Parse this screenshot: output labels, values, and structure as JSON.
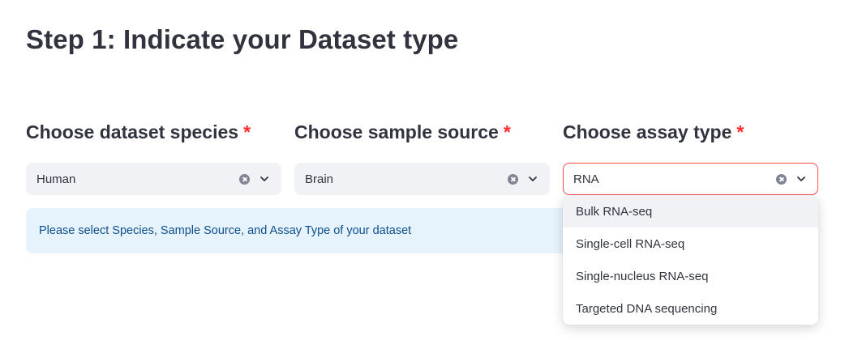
{
  "page": {
    "title": "Step 1: Indicate your Dataset type"
  },
  "fields": [
    {
      "label": "Choose dataset species",
      "required_marker": "*",
      "value": "Human"
    },
    {
      "label": "Choose sample source",
      "required_marker": "*",
      "value": "Brain"
    },
    {
      "label": "Choose assay type",
      "required_marker": "*",
      "value": "RNA"
    }
  ],
  "info": {
    "message": "Please select Species, Sample Source, and Assay Type of your dataset"
  },
  "dropdown": {
    "highlighted_index": 0,
    "options": [
      "Bulk RNA-seq",
      "Single-cell RNA-seq",
      "Single-nucleus RNA-seq",
      "Targeted DNA sequencing"
    ]
  },
  "colors": {
    "accent": "#ff4b4b",
    "required": "#ff2b2b",
    "info_bg": "#e6f2fc",
    "info_text": "#0c4f8c",
    "select_bg": "#f0f2f6"
  },
  "icons": {
    "clear": "clear-icon",
    "chevron": "chevron-down-icon"
  }
}
